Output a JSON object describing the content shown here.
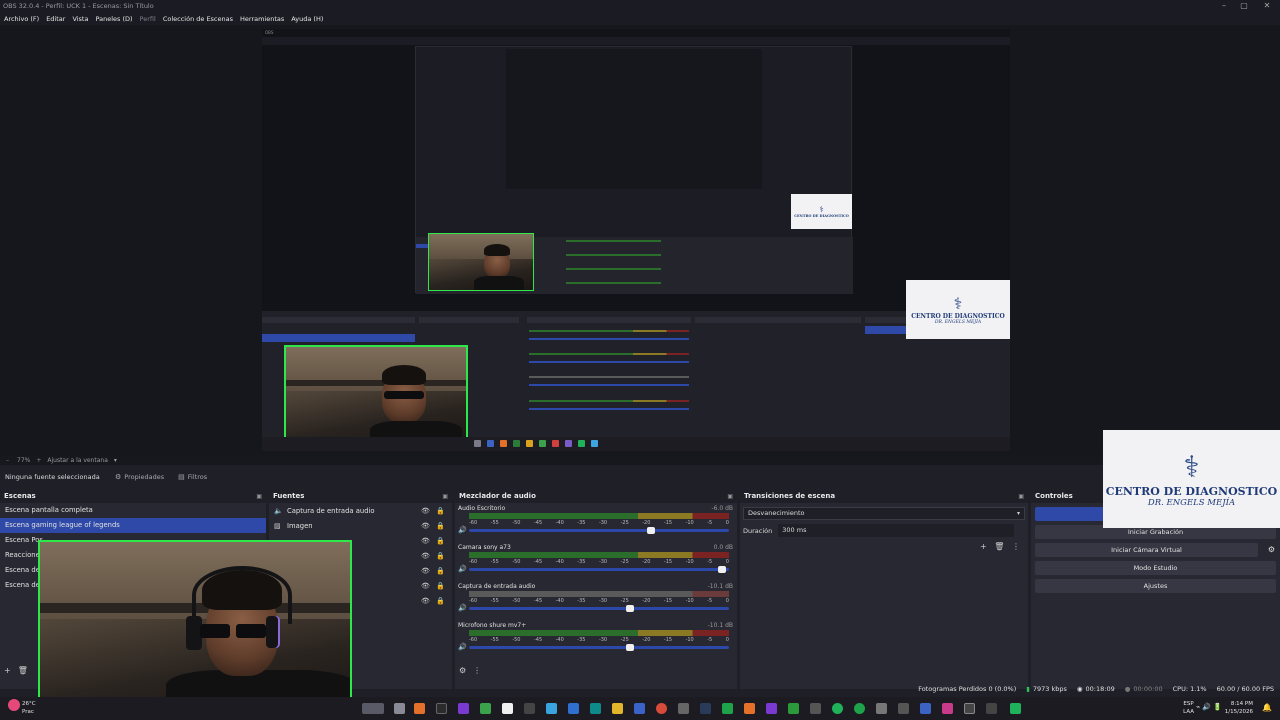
{
  "window": {
    "title": "OBS 32.0.4 - Perfil: UCK 1 - Escenas: Sin Título"
  },
  "menu": [
    "Archivo (F)",
    "Editar",
    "Vista",
    "Paneles (D)",
    "Perfil",
    "Colección de Escenas",
    "Herramientas",
    "Ayuda (H)"
  ],
  "zoom": {
    "value": "77%",
    "mode": "Ajustar a la ventana"
  },
  "toolbar": {
    "no_source": "Ninguna fuente seleccionada",
    "properties": "Propiedades",
    "filters": "Filtros"
  },
  "scenes": {
    "title": "Escenas",
    "items": [
      "Escena pantalla completa",
      "Escena gaming league of legends",
      "Escena Pos",
      "Reacciones",
      "Escena de",
      "Escena de"
    ],
    "selected_index": 1
  },
  "sources": {
    "title": "Fuentes",
    "items": [
      {
        "label": "Captura de entrada audio",
        "icon": "speaker-icon"
      },
      {
        "label": "Imagen",
        "icon": "image-icon"
      }
    ]
  },
  "mixer": {
    "title": "Mezclador de audio",
    "ticks": [
      "-60",
      "-55",
      "-50",
      "-45",
      "-40",
      "-35",
      "-30",
      "-25",
      "-20",
      "-15",
      "-10",
      "-5",
      "0"
    ],
    "channels": [
      {
        "name": "Audio Escritorio",
        "db": "-6.0 dB",
        "fader": 0.71,
        "meter_dim": false
      },
      {
        "name": "Camara sony a73",
        "db": "0.0 dB",
        "fader": 0.99,
        "meter_dim": false
      },
      {
        "name": "Captura de entrada audio",
        "db": "-10.1 dB",
        "fader": 0.63,
        "meter_dim": true
      },
      {
        "name": "Microfono shure mv7+",
        "db": "-10.1 dB",
        "fader": 0.63,
        "meter_dim": false
      }
    ]
  },
  "transitions": {
    "title": "Transiciones de escena",
    "selected": "Desvanecimiento",
    "duration_label": "Duración",
    "duration_value": "300 ms"
  },
  "controls": {
    "title": "Controles",
    "buttons": [
      "Iniciar Grabación",
      "Iniciar Cámara Virtual",
      "Modo Estudio",
      "Ajustes"
    ]
  },
  "status": {
    "dropped": "Fotogramas Perdidos 0 (0.0%)",
    "bitrate": "7973 kbps",
    "stream_time": "00:18:09",
    "rec_time": "00:00:00",
    "cpu": "CPU: 1.1%",
    "fps": "60.00 / 60.00 FPS"
  },
  "logo": {
    "line1": "CENTRO DE DIAGNOSTICO",
    "line2": "DR. ENGELS MEJÍA"
  },
  "taskbar": {
    "weather_temp": "26°C",
    "weather_desc": "Prac",
    "lang1": "ESP",
    "lang2": "LAA",
    "time": "8:14 PM",
    "date": "1/15/2026"
  },
  "colors": {
    "accent": "#2f49a8",
    "cam_border": "#2ee84a",
    "meter_green": "#2b6e2b",
    "meter_yellow": "#8b7a23",
    "meter_red": "#7b2222"
  }
}
